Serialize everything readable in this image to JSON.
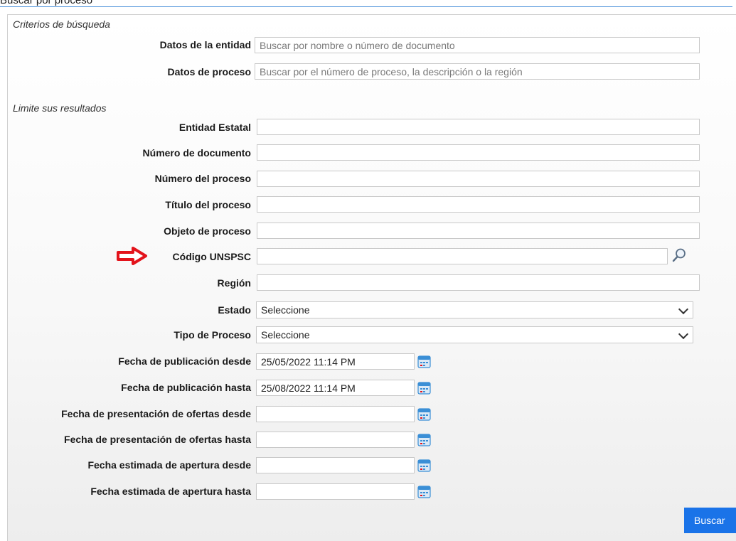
{
  "panel": {
    "title": "Buscar por proceso"
  },
  "criteria": {
    "heading": "Criterios de búsqueda",
    "entity_label": "Datos de la entidad",
    "entity_placeholder": "Buscar por nombre o número de documento",
    "process_label": "Datos de proceso",
    "process_placeholder": "Buscar por el número de proceso, la descripción o la región"
  },
  "limits": {
    "heading": "Limite sus resultados",
    "entidad_estatal": "Entidad Estatal",
    "numero_documento": "Número de documento",
    "numero_proceso": "Número del proceso",
    "titulo_proceso": "Título del proceso",
    "objeto_proceso": "Objeto de proceso",
    "codigo_unspsc": "Código UNSPSC",
    "region": "Región",
    "estado_label": "Estado",
    "estado_value": "Seleccione",
    "tipo_label": "Tipo de Proceso",
    "tipo_value": "Seleccione",
    "pub_desde_label": "Fecha de publicación desde",
    "pub_desde_value": "25/05/2022 11:14 PM",
    "pub_hasta_label": "Fecha de publicación hasta",
    "pub_hasta_value": "25/08/2022 11:14 PM",
    "ofertas_desde_label": "Fecha de presentación de ofertas desde",
    "ofertas_hasta_label": "Fecha de presentación de ofertas hasta",
    "apertura_desde_label": "Fecha estimada de apertura desde",
    "apertura_hasta_label": "Fecha estimada de apertura hasta"
  },
  "actions": {
    "search_label": "Buscar"
  },
  "colors": {
    "button": "#1a73e8",
    "arrow": "#e3131b",
    "calendar": "#3b8fd6"
  },
  "icons": {
    "arrow": "red-arrow-icon",
    "lookup": "magnifier-icon",
    "calendar": "calendar-icon",
    "dropdown": "chevron-down-icon"
  }
}
